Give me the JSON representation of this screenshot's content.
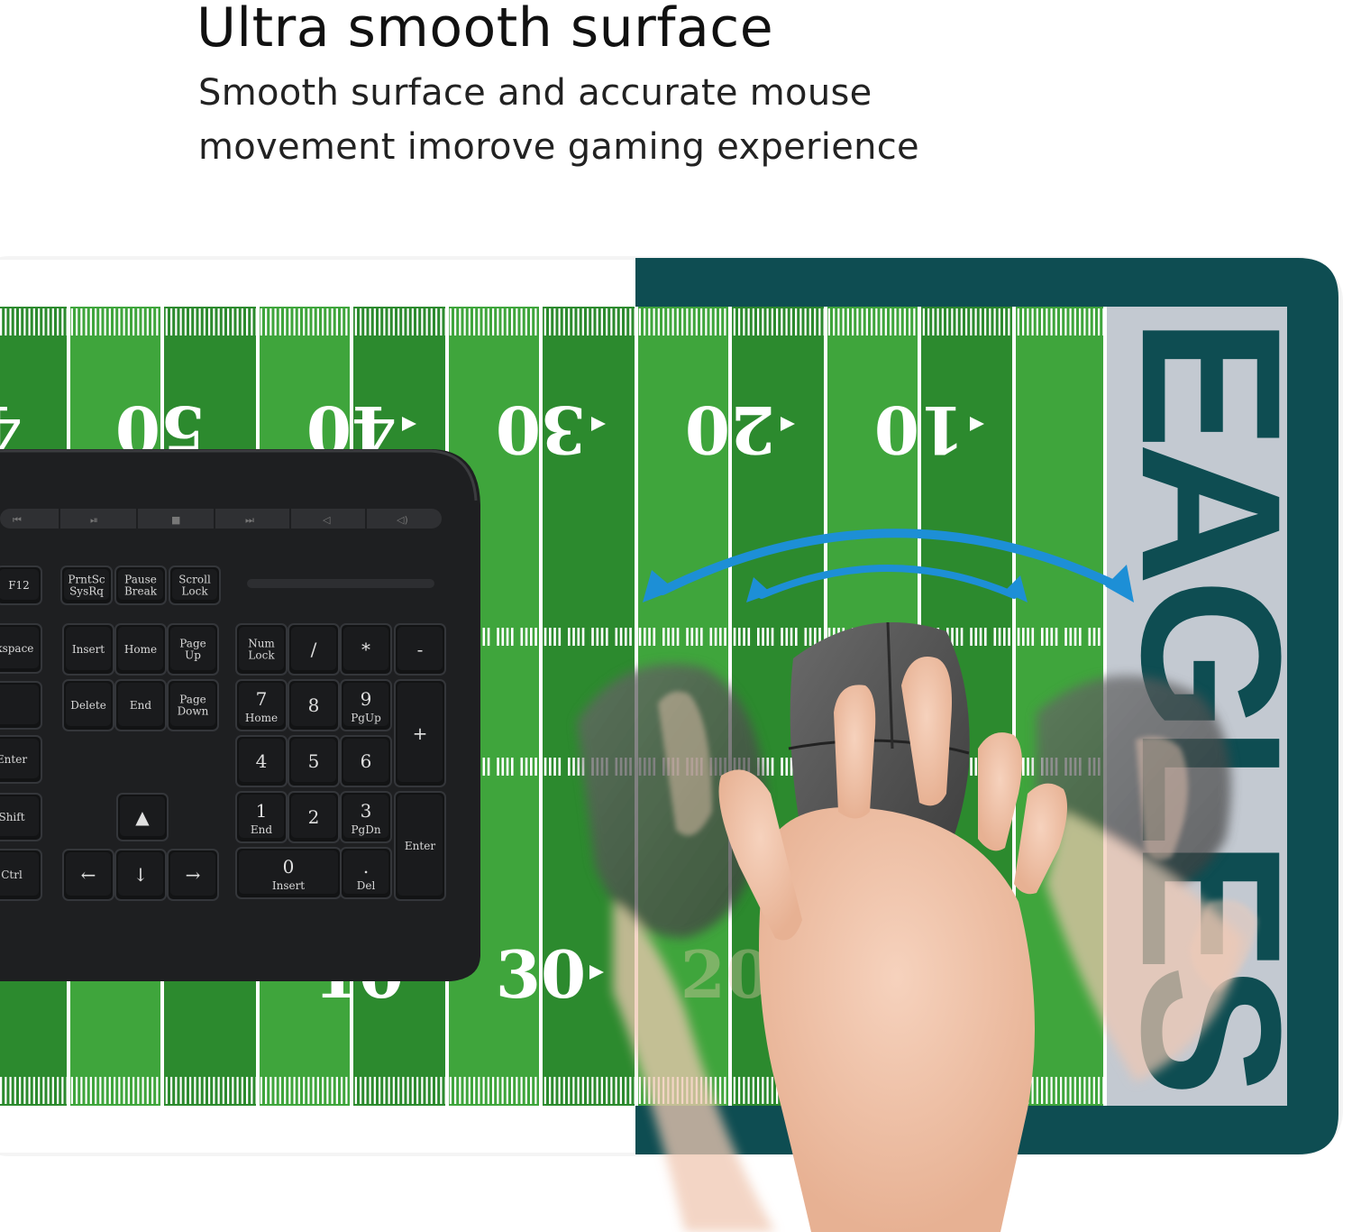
{
  "header": {
    "title": "Ultra smooth surface",
    "subtitle_line1": "Smooth surface and accurate mouse",
    "subtitle_line2": "movement imorove gaming experience"
  },
  "field": {
    "top_yard_numbers": [
      "4",
      "50",
      "40",
      "30",
      "20",
      "10"
    ],
    "bottom_yard_numbers": [
      "10",
      "30",
      "20"
    ],
    "endzone_text": "EAGLES",
    "colors": {
      "turf_dark": "#2c8a2e",
      "turf_light": "#3fa53c",
      "endzone": "#c3c9d1",
      "border": "#0e4d52",
      "arrow": "#1d8fd6"
    }
  },
  "keyboard": {
    "keys": {
      "f12": "F12",
      "prtsc": "PrntSc SysRq",
      "pause": "Pause Break",
      "scroll": "Scroll Lock",
      "backspace": "ckspace",
      "insert": "Insert",
      "home": "Home",
      "pageup": "Page Up",
      "numlock": "Num Lock",
      "slash": "/",
      "star": "*",
      "minus": "-",
      "delete": "Delete",
      "end": "End",
      "pagedown": "Page Down",
      "n7": "7",
      "n7sub": "Home",
      "n8": "8",
      "n9": "9",
      "n9sub": "PgUp",
      "plus": "+",
      "enter_left": "Enter",
      "n4": "4",
      "n5": "5",
      "n6": "6",
      "shift": "Shift",
      "n1": "1",
      "n1sub": "End",
      "n2": "2",
      "n3": "3",
      "n3sub": "PgDn",
      "enter_right": "Enter",
      "ctrl": "Ctrl",
      "n0": "0",
      "n0sub": "Insert",
      "dot": ".",
      "dotsub": "Del"
    }
  }
}
